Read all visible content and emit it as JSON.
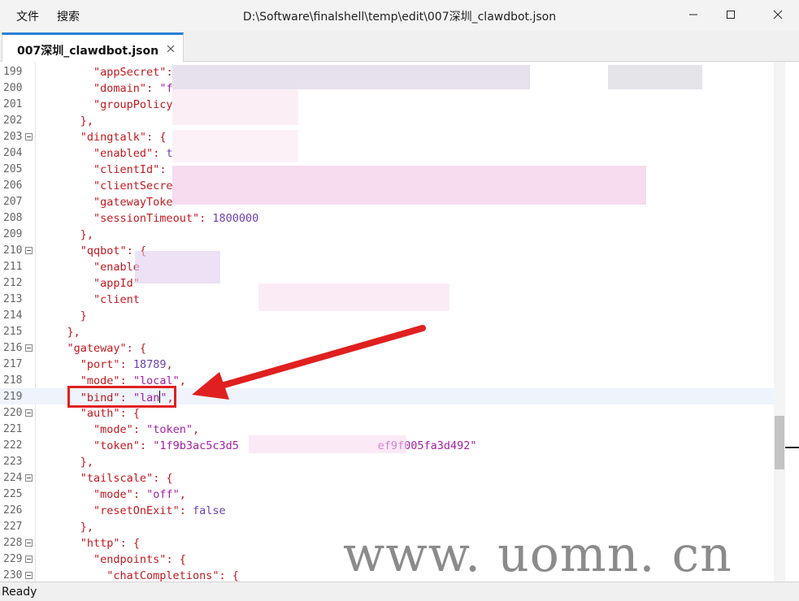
{
  "menubar": {
    "file": "文件",
    "search": "搜索"
  },
  "window": {
    "title": "D:\\Software\\finalshell\\temp\\edit\\007深圳_clawdbot.json"
  },
  "tabs": [
    {
      "label": "007深圳_clawdbot.json",
      "active": true
    }
  ],
  "editor": {
    "lines": [
      {
        "n": 199,
        "fold": false,
        "tokens": [
          [
            "i",
            "        "
          ],
          [
            "k",
            "\"appSecret\""
          ],
          [
            "p",
            ": "
          ]
        ]
      },
      {
        "n": 200,
        "fold": false,
        "tokens": [
          [
            "i",
            "        "
          ],
          [
            "k",
            "\"domain\""
          ],
          [
            "p",
            ": "
          ],
          [
            "s",
            "\"f"
          ]
        ]
      },
      {
        "n": 201,
        "fold": false,
        "tokens": [
          [
            "i",
            "        "
          ],
          [
            "k",
            "\"groupPolicy"
          ]
        ]
      },
      {
        "n": 202,
        "fold": false,
        "tokens": [
          [
            "i",
            "      "
          ],
          [
            "p",
            "},"
          ]
        ]
      },
      {
        "n": 203,
        "fold": true,
        "tokens": [
          [
            "i",
            "      "
          ],
          [
            "k",
            "\"dingtalk\""
          ],
          [
            "p",
            ": {"
          ]
        ]
      },
      {
        "n": 204,
        "fold": false,
        "tokens": [
          [
            "i",
            "        "
          ],
          [
            "k",
            "\"enabled\""
          ],
          [
            "p",
            ": "
          ],
          [
            "b",
            "t"
          ]
        ]
      },
      {
        "n": 205,
        "fold": false,
        "tokens": [
          [
            "i",
            "        "
          ],
          [
            "k",
            "\"clientId\""
          ],
          [
            "p",
            ":"
          ]
        ]
      },
      {
        "n": 206,
        "fold": false,
        "tokens": [
          [
            "i",
            "        "
          ],
          [
            "k",
            "\"clientSecre"
          ]
        ]
      },
      {
        "n": 207,
        "fold": false,
        "tokens": [
          [
            "i",
            "        "
          ],
          [
            "k",
            "\"gatewayToke"
          ]
        ]
      },
      {
        "n": 208,
        "fold": false,
        "tokens": [
          [
            "i",
            "        "
          ],
          [
            "k",
            "\"sessionTimeout\""
          ],
          [
            "p",
            ": "
          ],
          [
            "n",
            "1800000"
          ]
        ]
      },
      {
        "n": 209,
        "fold": false,
        "tokens": [
          [
            "i",
            "      "
          ],
          [
            "p",
            "},"
          ]
        ]
      },
      {
        "n": 210,
        "fold": true,
        "tokens": [
          [
            "i",
            "      "
          ],
          [
            "k",
            "\"qqbot\""
          ],
          [
            "p",
            ": {"
          ]
        ]
      },
      {
        "n": 211,
        "fold": false,
        "tokens": [
          [
            "i",
            "        "
          ],
          [
            "k",
            "\"enable"
          ]
        ]
      },
      {
        "n": 212,
        "fold": false,
        "tokens": [
          [
            "i",
            "        "
          ],
          [
            "k",
            "\"appId\""
          ]
        ]
      },
      {
        "n": 213,
        "fold": false,
        "tokens": [
          [
            "i",
            "        "
          ],
          [
            "k",
            "\"client"
          ]
        ]
      },
      {
        "n": 214,
        "fold": false,
        "tokens": [
          [
            "i",
            "      "
          ],
          [
            "p",
            "}"
          ]
        ]
      },
      {
        "n": 215,
        "fold": false,
        "tokens": [
          [
            "i",
            "    "
          ],
          [
            "p",
            "},"
          ]
        ]
      },
      {
        "n": 216,
        "fold": true,
        "tokens": [
          [
            "i",
            "    "
          ],
          [
            "k",
            "\"gateway\""
          ],
          [
            "p",
            ": {"
          ]
        ]
      },
      {
        "n": 217,
        "fold": false,
        "tokens": [
          [
            "i",
            "      "
          ],
          [
            "k",
            "\"port\""
          ],
          [
            "p",
            ": "
          ],
          [
            "n",
            "18789"
          ],
          [
            "p",
            ","
          ]
        ]
      },
      {
        "n": 218,
        "fold": false,
        "tokens": [
          [
            "i",
            "      "
          ],
          [
            "k",
            "\"mode\""
          ],
          [
            "p",
            ": "
          ],
          [
            "s",
            "\"local\""
          ],
          [
            "p",
            ","
          ]
        ]
      },
      {
        "n": 219,
        "fold": false,
        "current": true,
        "tokens": [
          [
            "i",
            "      "
          ],
          [
            "k",
            "\"bind\""
          ],
          [
            "p",
            ": "
          ],
          [
            "s",
            "\"lan"
          ],
          [
            "c",
            ""
          ],
          [
            "s",
            "\""
          ],
          [
            "p",
            ","
          ]
        ]
      },
      {
        "n": 220,
        "fold": true,
        "tokens": [
          [
            "i",
            "      "
          ],
          [
            "k",
            "\"auth\""
          ],
          [
            "p",
            ": {"
          ]
        ]
      },
      {
        "n": 221,
        "fold": false,
        "tokens": [
          [
            "i",
            "        "
          ],
          [
            "k",
            "\"mode\""
          ],
          [
            "p",
            ": "
          ],
          [
            "s",
            "\"token\""
          ],
          [
            "p",
            ","
          ]
        ]
      },
      {
        "n": 222,
        "fold": false,
        "tokens": [
          [
            "i",
            "        "
          ],
          [
            "k",
            "\"token\""
          ],
          [
            "p",
            ": "
          ],
          [
            "s",
            "\"1f9b3ac5c3d5"
          ],
          [
            "i",
            "                     "
          ],
          [
            "s",
            "ef9f005fa3d492\""
          ]
        ]
      },
      {
        "n": 223,
        "fold": false,
        "tokens": [
          [
            "i",
            "      "
          ],
          [
            "p",
            "},"
          ]
        ]
      },
      {
        "n": 224,
        "fold": true,
        "tokens": [
          [
            "i",
            "      "
          ],
          [
            "k",
            "\"tailscale\""
          ],
          [
            "p",
            ": {"
          ]
        ]
      },
      {
        "n": 225,
        "fold": false,
        "tokens": [
          [
            "i",
            "        "
          ],
          [
            "k",
            "\"mode\""
          ],
          [
            "p",
            ": "
          ],
          [
            "s",
            "\"off\""
          ],
          [
            "p",
            ","
          ]
        ]
      },
      {
        "n": 226,
        "fold": false,
        "tokens": [
          [
            "i",
            "        "
          ],
          [
            "k",
            "\"resetOnExit\""
          ],
          [
            "p",
            ": "
          ],
          [
            "b",
            "false"
          ]
        ]
      },
      {
        "n": 227,
        "fold": false,
        "tokens": [
          [
            "i",
            "      "
          ],
          [
            "p",
            "},"
          ]
        ]
      },
      {
        "n": 228,
        "fold": true,
        "tokens": [
          [
            "i",
            "      "
          ],
          [
            "k",
            "\"http\""
          ],
          [
            "p",
            ": {"
          ]
        ]
      },
      {
        "n": 229,
        "fold": true,
        "tokens": [
          [
            "i",
            "        "
          ],
          [
            "k",
            "\"endpoints\""
          ],
          [
            "p",
            ": {"
          ]
        ]
      },
      {
        "n": 230,
        "fold": true,
        "tokens": [
          [
            "i",
            "          "
          ],
          [
            "k",
            "\"chatCompletions\""
          ],
          [
            "p",
            ": {"
          ]
        ]
      }
    ]
  },
  "statusbar": {
    "text": "Ready"
  },
  "watermark": "www. uomn. cn",
  "colors": {
    "accent_tab": "#2b7fd9",
    "key": "#c2191f",
    "string": "#a51ea5",
    "number": "#6a3fb0",
    "annotation": "#e02020"
  },
  "icons": {
    "minimize": "minimize-icon",
    "maximize": "maximize-icon",
    "close": "close-icon",
    "tab_close": "tab-close-icon",
    "fold": "fold-minus-icon"
  }
}
